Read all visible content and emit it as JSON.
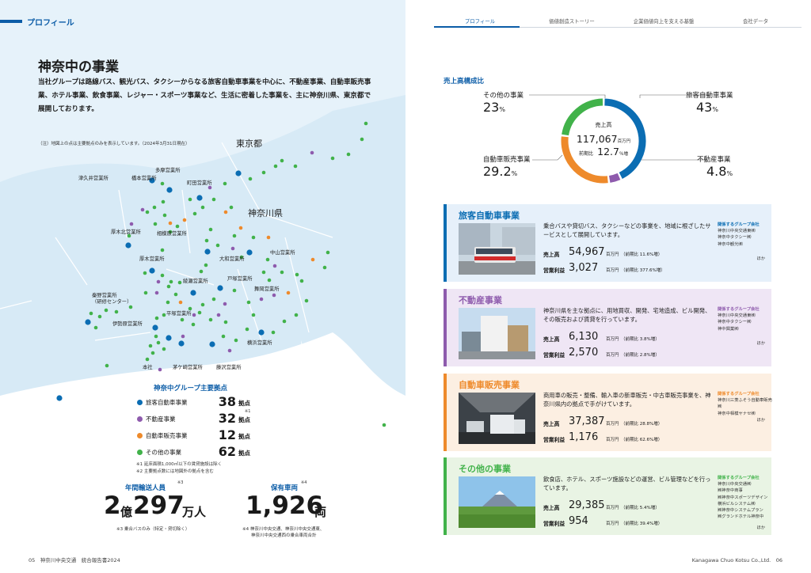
{
  "left": {
    "section_label": "プロフィール",
    "title": "神奈中の事業",
    "intro": "当社グループは路線バス、観光バス、タクシーからなる旅客自動車事業を中心に、不動産事業、自動車販売事業、ホテル事業、飲食事業、レジャー・スポーツ事業など、生活に密着した事業を、主に神奈川県、東京都で展開しております。",
    "map_note": "（注）地図上の点は主要拠点のみを表示しています。（2024年3月31日現在）",
    "map_labels": {
      "tokyo": "東京都",
      "kanagawa": "神奈川県",
      "tama": "多摩営業所",
      "hashimoto": "橋本営業所",
      "tsukui": "津久井営業所",
      "machida": "町田営業所",
      "sagamihara": "相模原営業所",
      "atsugi_kita": "厚木北営業所",
      "atsugi": "厚木営業所",
      "yamato": "大和営業所",
      "nakayama": "中山営業所",
      "ayase": "綾瀬営業所",
      "totsuka": "戸塚営業所",
      "maioka": "舞岡営業所",
      "hadano_line1": "秦野営業所",
      "hadano_line2": "（研修センター）",
      "isehara": "伊勢原営業所",
      "hiratsuka": "平塚営業所",
      "yokohama": "横浜営業所",
      "honsha": "本社",
      "chigasaki": "茅ケ崎営業所",
      "fujisawa": "藤沢営業所"
    },
    "legend": {
      "title": "神奈中グループ主要拠点",
      "rows": [
        {
          "label": "旅客自動車事業",
          "value": "38",
          "unit": "拠点",
          "color": "#0b6db3"
        },
        {
          "label": "不動産事業",
          "value": "32",
          "unit": "拠点",
          "color": "#8e5bad"
        },
        {
          "label": "自動車販売事業",
          "value": "12",
          "unit": "拠点",
          "color": "#ee8a2b"
        },
        {
          "label": "その他の事業",
          "value": "62",
          "unit": "拠点",
          "color": "#41b24a"
        }
      ],
      "sup_mark": "※1",
      "note1": "※1 延床面積1,000㎡以下の賃貸施設は除く",
      "note2": "※2 主要拠点数には地図外の拠点を含む"
    },
    "stats": {
      "passengers_label": "年間輸送人員",
      "passengers_sup": "※3",
      "passengers_big1": "2",
      "passengers_unit1": "億",
      "passengers_big2": "297",
      "passengers_unit2": "万人",
      "passengers_note": "※3 乗合バスのみ（特定・貸切除く）",
      "vehicles_label": "保有車両",
      "vehicles_sup": "※4",
      "vehicles_big": "1,926",
      "vehicles_unit": "両",
      "vehicles_note1": "※4 神奈川中央交通、神奈川中央交通東、",
      "vehicles_note2": "神奈川中央交通西の乗合車両合計"
    },
    "page_number": "05　神奈川中央交通　統合報告書2024"
  },
  "right": {
    "tabs": [
      "プロフィール",
      "価値創造ストーリー",
      "企業価値向上を支える基盤",
      "会社データ"
    ],
    "chart_data": {
      "type": "pie",
      "title": "売上高構成比",
      "categories": [
        "旅客自動車事業",
        "不動産事業",
        "自動車販売事業",
        "その他の事業"
      ],
      "values": [
        43.0,
        4.8,
        29.2,
        23.0
      ],
      "colors": [
        "#0b6db3",
        "#8e5bad",
        "#ee8a2b",
        "#41b24a"
      ],
      "center": {
        "label": "売上高",
        "value": "117,067",
        "unit": "百万円",
        "growth_label": "前期比",
        "growth": "12.7",
        "growth_unit": "％増"
      }
    },
    "pct_unit": "%",
    "segments": [
      {
        "name": "旅客自動車事業",
        "accent": "#0b6db3",
        "bg": "#e6f0fa",
        "desc": "乗合バスや貸切バス、タクシーなどの事業を、地域に根ざしたサービスとして展開しています。",
        "sales_label": "売上高",
        "sales": "54,967",
        "sales_unit": "百万円",
        "sales_growth": "（前期比 11.6%増）",
        "profit_label": "営業利益",
        "profit": "3,027",
        "profit_unit": "百万円",
        "profit_growth": "（前期比 377.6%増）",
        "group_title": "関係するグループ会社",
        "companies": [
          "神奈川中央交通東㈱",
          "神奈中タクシー㈱",
          "神奈中観光㈱"
        ],
        "hoka": "ほか"
      },
      {
        "name": "不動産事業",
        "accent": "#8e5bad",
        "bg": "#efe6f5",
        "desc": "神奈川県を主な拠点に、用地買収、開発、宅地造成、ビル開発、その販売および賃貸を行っています。",
        "sales_label": "売上高",
        "sales": "6,130",
        "sales_unit": "百万円",
        "sales_growth": "（前期比 3.8%増）",
        "profit_label": "営業利益",
        "profit": "2,570",
        "profit_unit": "百万円",
        "profit_growth": "（前期比 2.8%増）",
        "group_title": "関係するグループ会社",
        "companies": [
          "神奈川中央交通東㈱",
          "神奈中タクシー㈱",
          "神中興業㈱"
        ],
        "hoka": "ほか"
      },
      {
        "name": "自動車販売事業",
        "accent": "#ee8a2b",
        "bg": "#fcefe2",
        "desc": "商用車の販売・整備、輸入車の新車販売・中古車販売事業を、神奈川県内の拠点で手がけています。",
        "sales_label": "売上高",
        "sales": "37,387",
        "sales_unit": "百万円",
        "sales_growth": "（前期比 28.8%増）",
        "profit_label": "営業利益",
        "profit": "1,176",
        "profit_unit": "百万円",
        "profit_growth": "（前期比 62.6%増）",
        "group_title": "関係するグループ会社",
        "companies": [
          "神奈川三菱ふそう自動車販売㈱",
          "神奈中相模ヤナセ㈱"
        ],
        "hoka": "ほか"
      },
      {
        "name": "その他の事業",
        "accent": "#41b24a",
        "bg": "#e9f4e4",
        "desc": "飲食店、ホテル、スポーツ施設などの運営、ビル管理などを行っています。",
        "sales_label": "売上高",
        "sales": "29,385",
        "sales_unit": "百万円",
        "sales_growth": "（前期比 5.4%増）",
        "profit_label": "営業利益",
        "profit": "954",
        "profit_unit": "百万円",
        "profit_growth": "（前期比 39.4%増）",
        "group_title": "関係するグループ会社",
        "companies": [
          "神奈川中央交通㈱",
          "㈱神奈中商事",
          "㈱神奈中スポーツデザイン",
          "横浜ビルシステム㈱",
          "㈱神奈中システムプラン",
          "㈱グランドホテル神奈中"
        ],
        "hoka": "ほか"
      }
    ],
    "page_number": "Kanagawa Chuo Kotsu Co.,Ltd.　06"
  }
}
